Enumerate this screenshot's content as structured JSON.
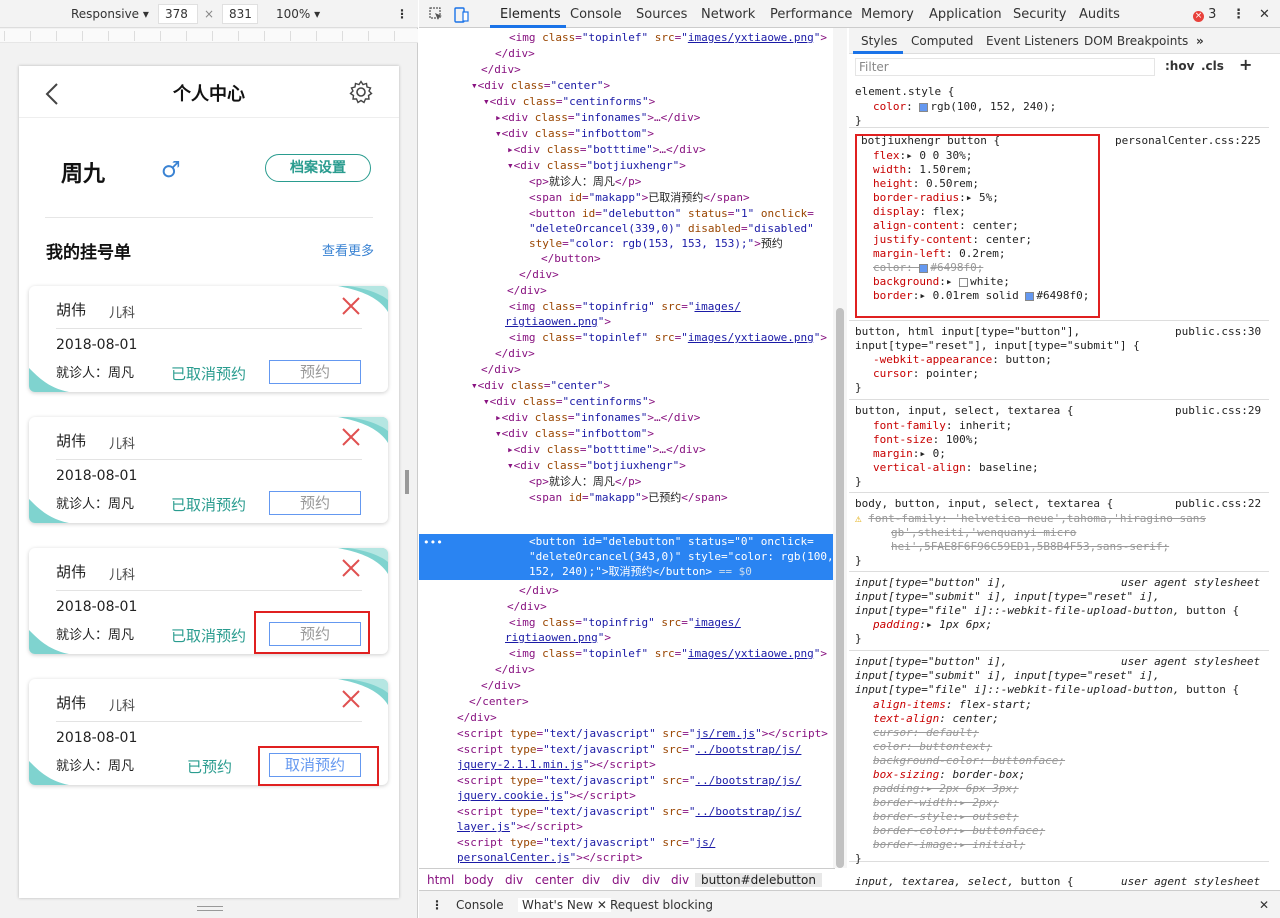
{
  "device_toolbar": {
    "device": "Responsive",
    "width": "378",
    "times": "×",
    "height": "831",
    "zoom": "100%"
  },
  "phone": {
    "title": "个人中心",
    "user_name": "周九",
    "gender_symbol": "♂",
    "profile_button": "档案设置",
    "section_title": "我的挂号单",
    "see_more": "查看更多",
    "cards": [
      {
        "doctor": "胡伟",
        "dept": "儿科",
        "date": "2018-08-01",
        "patient": "就诊人：周凡",
        "status": "已取消预约",
        "button": "预约"
      },
      {
        "doctor": "胡伟",
        "dept": "儿科",
        "date": "2018-08-01",
        "patient": "就诊人：周凡",
        "status": "已取消预约",
        "button": "预约"
      },
      {
        "doctor": "胡伟",
        "dept": "儿科",
        "date": "2018-08-01",
        "patient": "就诊人：周凡",
        "status": "已取消预约",
        "button": "预约"
      },
      {
        "doctor": "胡伟",
        "dept": "儿科",
        "date": "2018-08-01",
        "patient": "就诊人：周凡",
        "status": "已预约",
        "button": "取消预约"
      }
    ]
  },
  "devtools": {
    "tabs": [
      "Elements",
      "Console",
      "Sources",
      "Network",
      "Performance",
      "Memory",
      "Application",
      "Security",
      "Audits"
    ],
    "error_count": "3",
    "breadcrumbs": [
      "html",
      "body",
      "div",
      "center",
      "div",
      "div",
      "div",
      "div",
      "button#delebutton"
    ],
    "drawer_tabs": [
      "Console",
      "What's New",
      "Request blocking"
    ],
    "styles_tabs": [
      "Styles",
      "Computed",
      "Event Listeners",
      "DOM Breakpoints"
    ],
    "filter_placeholder": "Filter",
    "hov": ":hov",
    "cls": ".cls",
    "colors": {
      "accent": "#1a73e8",
      "selection": "#2a84f2",
      "button_border": "#6498f0",
      "status_teal": "#2a9c8f"
    }
  }
}
